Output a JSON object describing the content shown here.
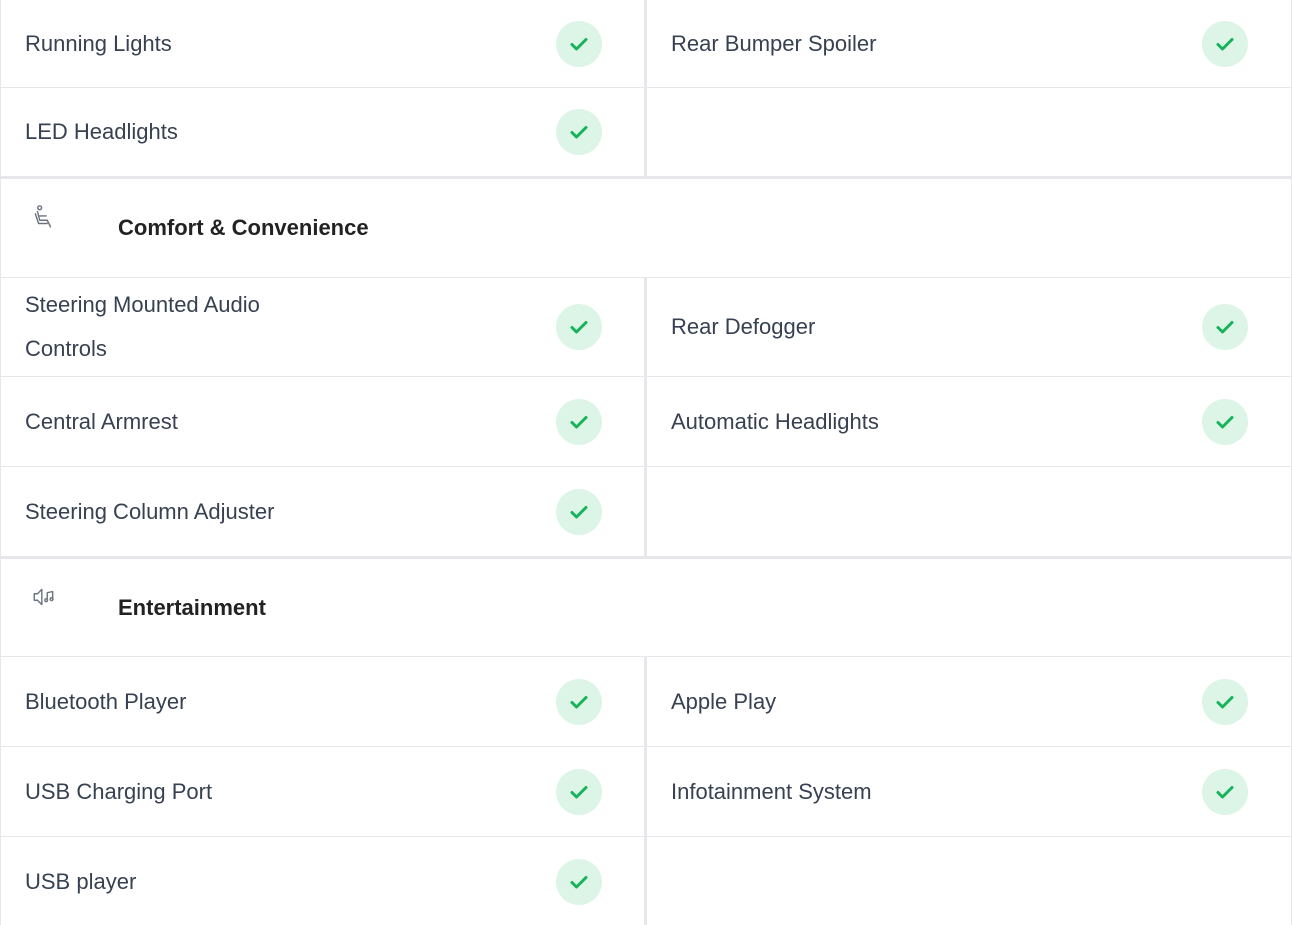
{
  "colors": {
    "check_bg": "#dcf5e6",
    "check_mark": "#16b35a",
    "border": "#e5e7eb"
  },
  "exterior_rows": [
    {
      "left": "Running Lights",
      "right": "Rear Bumper Spoiler"
    },
    {
      "left": "LED Headlights",
      "right": ""
    }
  ],
  "comfort": {
    "title": "Comfort & Convenience",
    "icon": "seat-icon",
    "rows": [
      {
        "left": "Steering Mounted Audio Controls",
        "right": "Rear Defogger"
      },
      {
        "left": "Central Armrest",
        "right": "Automatic Headlights"
      },
      {
        "left": "Steering Column Adjuster",
        "right": ""
      }
    ]
  },
  "entertainment": {
    "title": "Entertainment",
    "icon": "speaker-music-icon",
    "rows": [
      {
        "left": "Bluetooth Player",
        "right": "Apple Play"
      },
      {
        "left": "USB Charging Port",
        "right": "Infotainment System"
      },
      {
        "left": "USB player",
        "right": ""
      }
    ]
  }
}
